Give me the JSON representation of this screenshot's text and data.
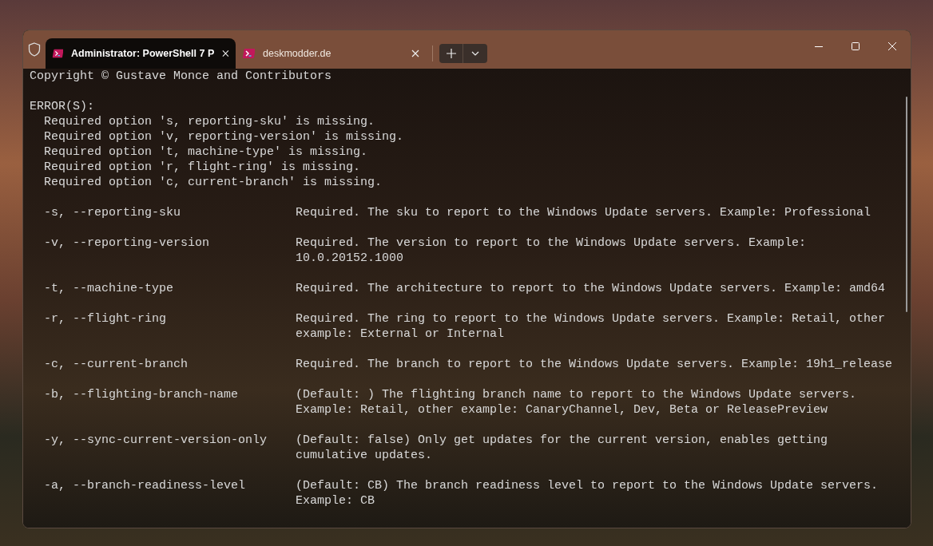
{
  "tabs": [
    {
      "title": "Administrator: PowerShell 7 P",
      "selected": true
    },
    {
      "title": "deskmodder.de",
      "selected": false
    }
  ],
  "terminal": {
    "header": "Copyright © Gustave Monce and Contributors",
    "errors_title": "ERROR(S):",
    "errors": [
      "Required option 's, reporting-sku' is missing.",
      "Required option 'v, reporting-version' is missing.",
      "Required option 't, machine-type' is missing.",
      "Required option 'r, flight-ring' is missing.",
      "Required option 'c, current-branch' is missing."
    ],
    "options": [
      {
        "flag": "-s, --reporting-sku",
        "description": [
          "Required. The sku to report to the Windows Update servers. Example: Professional"
        ]
      },
      {
        "flag": "-v, --reporting-version",
        "description": [
          "Required. The version to report to the Windows Update servers. Example:",
          "10.0.20152.1000"
        ]
      },
      {
        "flag": "-t, --machine-type",
        "description": [
          "Required. The architecture to report to the Windows Update servers. Example: amd64"
        ]
      },
      {
        "flag": "-r, --flight-ring",
        "description": [
          "Required. The ring to report to the Windows Update servers. Example: Retail, other",
          "example: External or Internal"
        ]
      },
      {
        "flag": "-c, --current-branch",
        "description": [
          "Required. The branch to report to the Windows Update servers. Example: 19h1_release"
        ]
      },
      {
        "flag": "-b, --flighting-branch-name",
        "description": [
          "(Default: ) The flighting branch name to report to the Windows Update servers.",
          "Example: Retail, other example: CanaryChannel, Dev, Beta or ReleasePreview"
        ]
      },
      {
        "flag": "-y, --sync-current-version-only",
        "description": [
          "(Default: false) Only get updates for the current version, enables getting",
          "cumulative updates."
        ]
      },
      {
        "flag": "-a, --branch-readiness-level",
        "description": [
          "(Default: CB) The branch readiness level to report to the Windows Update servers.",
          "Example: CB"
        ]
      }
    ]
  }
}
